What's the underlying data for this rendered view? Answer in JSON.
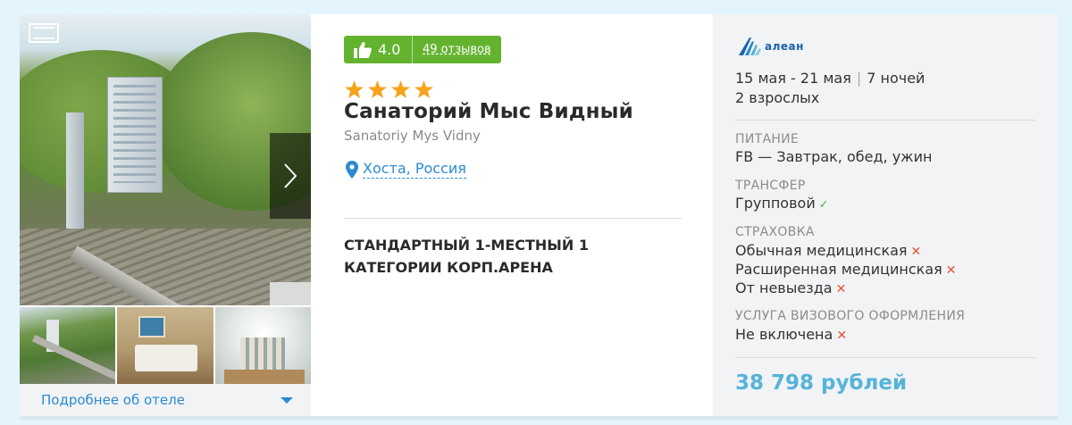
{
  "gallery": {
    "more_label": "Подробнее об отеле",
    "thumbnails": [
      "thumb-exterior",
      "thumb-room",
      "thumb-hall"
    ]
  },
  "hotel": {
    "rating": "4.0",
    "reviews": "49 отзывов",
    "stars": 4,
    "name": "Санаторий Мыс Видный",
    "name_latin": "Sanatoriy Mys Vidny",
    "location": "Хоста, Россия",
    "room": "Стандартный 1-местный 1 категории корп.Арена"
  },
  "offer": {
    "operator": "алеан",
    "dates": "15 мая - 21 мая",
    "nights": "7 ночей",
    "guests": "2 взрослых",
    "meal_label": "ПИТАНИЕ",
    "meal_value": "FB — Завтрак, обед, ужин",
    "transfer_label": "ТРАНСФЕР",
    "transfer_value": "Групповой",
    "insurance_label": "СТРАХОВКА",
    "insurance": [
      {
        "name": "Обычная медицинская",
        "included": false
      },
      {
        "name": "Расширенная медицинская",
        "included": false
      },
      {
        "name": "От невыезда",
        "included": false
      }
    ],
    "visa_label": "УСЛУГА ВИЗОВОГО ОФОРМЛЕНИЯ",
    "visa_value": "Не включена",
    "price": "38 798 рублей"
  },
  "colors": {
    "background": "#e3f4fc",
    "link": "#2b8bd0",
    "rating_badge": "#63b32e",
    "star": "#f7a21b",
    "price": "#56b3d9",
    "included": "#5ab02c",
    "excluded": "#e8522f"
  }
}
